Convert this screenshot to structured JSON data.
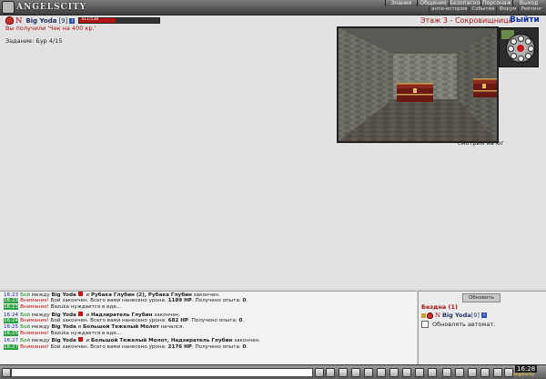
{
  "app": {
    "logo_text": "ANGELSCITY"
  },
  "topnav": [
    "Знания",
    "Общение",
    "Безопасность",
    "Персонаж",
    "Выход"
  ],
  "subnav": [
    "анти-история",
    "События",
    "Форум",
    "Рейтинг"
  ],
  "player": {
    "name": "Big Yoda",
    "level": "[9]",
    "info_badge": "i",
    "hp_text": "411/538",
    "hp_fraction": 0.45
  },
  "received_message": "Вы получили 'Чек на 400 кр.'",
  "task": "Задание: Бур 4/15",
  "location": {
    "floor": "Этаж 3 - Сокровищница",
    "exit_label": "Выйти"
  },
  "view_caption": "смотрим на юг",
  "chat": [
    {
      "time": "16:23",
      "hl": false,
      "parts": [
        [
          "fight",
          "Бой"
        ],
        [
          "n",
          " между "
        ],
        [
          "b",
          "Big Yoda"
        ],
        [
          "flag",
          ""
        ],
        [
          "n",
          " и "
        ],
        [
          "b",
          "Рубака Глубин (2), Рубака Глубин"
        ],
        [
          "n",
          " закончен."
        ]
      ]
    },
    {
      "time": "16:23",
      "hl": true,
      "parts": [
        [
          "warn",
          "Внимание!"
        ],
        [
          "n",
          " Бой закончен. Всего вами нанесено урона: "
        ],
        [
          "b",
          "1189 HP"
        ],
        [
          "n",
          ". Получено опыта: "
        ],
        [
          "b",
          "0"
        ],
        [
          "n",
          "."
        ]
      ]
    },
    {
      "time": "16:23",
      "hl": true,
      "parts": [
        [
          "warn",
          "Внимание!"
        ],
        [
          "n",
          " Bazuka нуждается в еде..."
        ]
      ]
    },
    {
      "time": "16:24",
      "hl": false,
      "parts": [
        [
          "fight",
          "Бой"
        ],
        [
          "n",
          " между "
        ],
        [
          "b",
          "Big Yoda"
        ],
        [
          "flag",
          ""
        ],
        [
          "n",
          " и "
        ],
        [
          "b",
          "Надзиратель Глубин"
        ],
        [
          "n",
          " закончен."
        ]
      ]
    },
    {
      "time": "16:24",
      "hl": true,
      "parts": [
        [
          "warn",
          "Внимание!"
        ],
        [
          "n",
          " Бой закончен. Всего вами нанесено урона: "
        ],
        [
          "b",
          "682 HP"
        ],
        [
          "n",
          ". Получено опыта: "
        ],
        [
          "b",
          "0"
        ],
        [
          "n",
          "."
        ]
      ]
    },
    {
      "time": "16:25",
      "hl": false,
      "parts": [
        [
          "fight",
          "Бой"
        ],
        [
          "n",
          " между "
        ],
        [
          "b",
          "Big Yoda"
        ],
        [
          "n",
          " и "
        ],
        [
          "b",
          "Большой Тяжелый Молот"
        ],
        [
          "n",
          " начался."
        ]
      ]
    },
    {
      "time": "16:25",
      "hl": true,
      "parts": [
        [
          "warn",
          "Внимание!"
        ],
        [
          "n",
          " Bazuka нуждается в еде..."
        ]
      ]
    },
    {
      "time": "16:27",
      "hl": false,
      "parts": [
        [
          "fight",
          "Бой"
        ],
        [
          "n",
          " между "
        ],
        [
          "b",
          "Big Yoda"
        ],
        [
          "flag",
          ""
        ],
        [
          "n",
          " и "
        ],
        [
          "b",
          "Большой Тяжелый Молот, Надзиратель Глубин"
        ],
        [
          "n",
          " закончен."
        ]
      ]
    },
    {
      "time": "16:27",
      "hl": true,
      "parts": [
        [
          "warn",
          "Внимание!"
        ],
        [
          "n",
          " Бой закончен. Всего вами нанесено урона: "
        ],
        [
          "b",
          "2176 HP"
        ],
        [
          "n",
          ". Получено опыта: "
        ],
        [
          "b",
          "0"
        ],
        [
          "n",
          "."
        ]
      ]
    }
  ],
  "right_panel": {
    "refresh_label": "Обновить",
    "abyss_title": "Бездна (1)",
    "member_name": "Big Yoda",
    "member_level": "[9]",
    "auto_refresh_label": "Обновлять автомат."
  },
  "clock": {
    "time": "16:28",
    "sub": "angelscity"
  }
}
